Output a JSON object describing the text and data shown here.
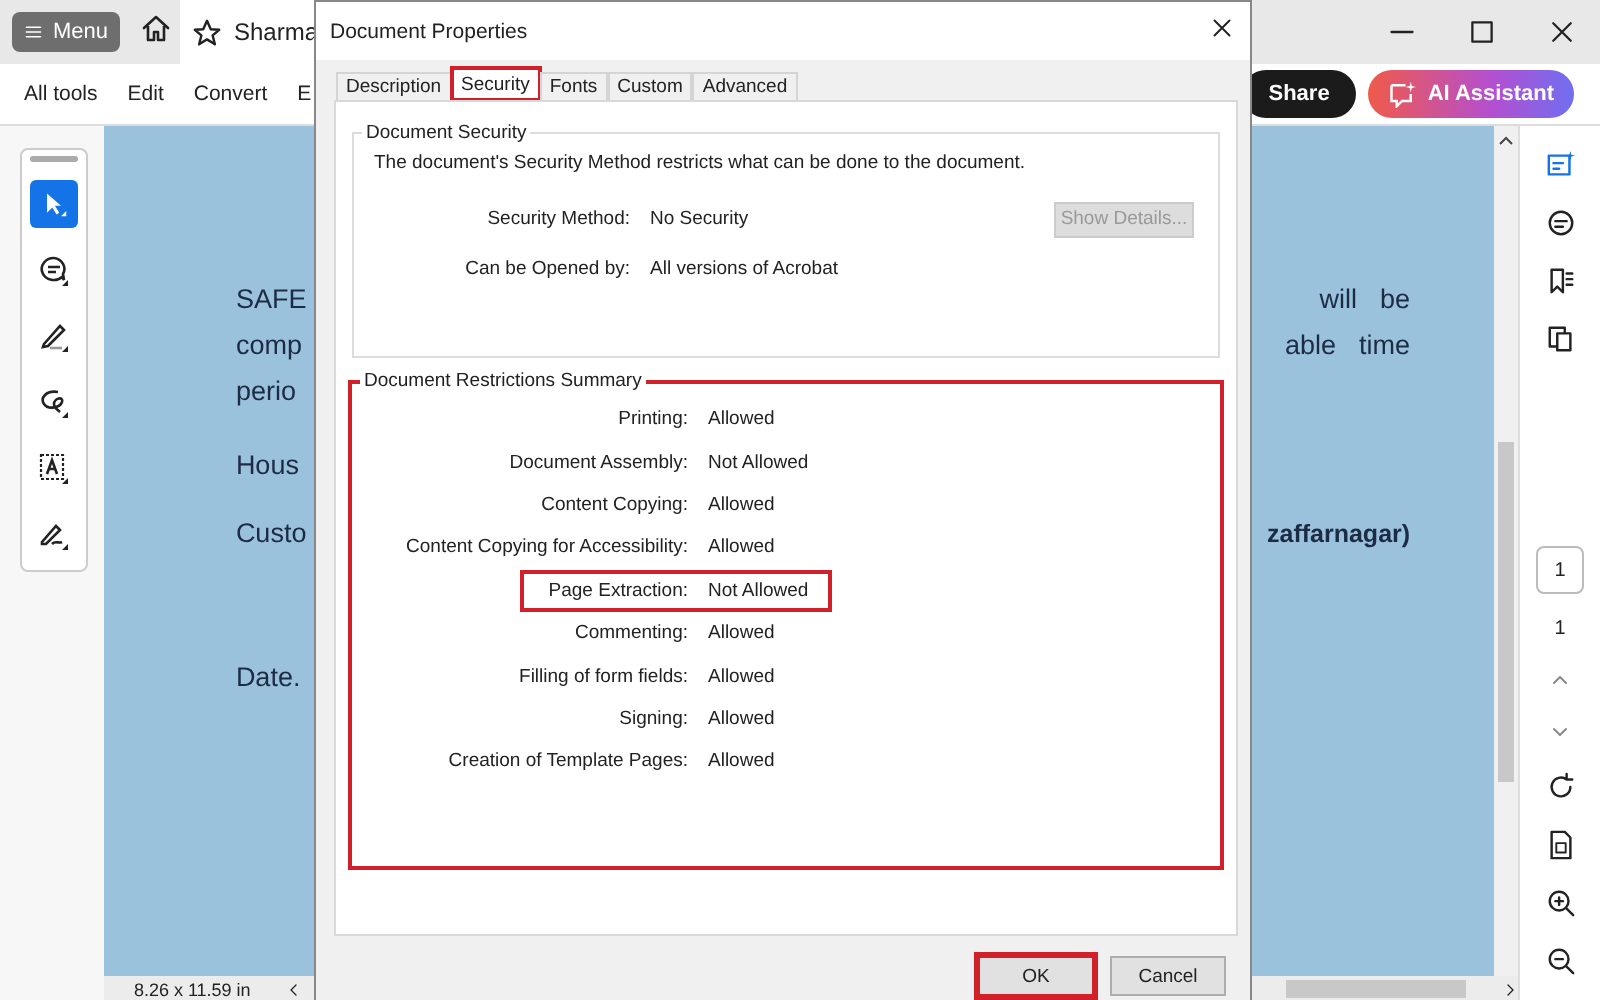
{
  "app": {
    "menu_button": "Menu",
    "tab_title": "Sharma",
    "toolbar": [
      "All tools",
      "Edit",
      "Convert",
      "E"
    ],
    "share": "Share",
    "ai_assistant": "AI Assistant"
  },
  "tools": [
    {
      "kind": "select",
      "selected": true
    },
    {
      "kind": "comment",
      "selected": false
    },
    {
      "kind": "draw",
      "selected": false
    },
    {
      "kind": "lasso",
      "selected": false
    },
    {
      "kind": "text",
      "selected": false
    },
    {
      "kind": "sign",
      "selected": false
    }
  ],
  "document": {
    "lines": [
      {
        "left": "SAFE",
        "right": "will  be",
        "bold": false
      },
      {
        "left": "comp",
        "right": "able  time",
        "bold": false
      },
      {
        "left": "perio"
      },
      {
        "left": "Hous"
      },
      {
        "left": "Custo",
        "right": "zaffarnagar)",
        "bold": true
      },
      {
        "left": "Date."
      }
    ]
  },
  "status_bar": "8.26 x 11.59 in",
  "page_nav": {
    "current": "1",
    "total": "1"
  },
  "dialog": {
    "title": "Document Properties",
    "tabs": [
      {
        "label": "Description",
        "selected": false,
        "highlighted": false
      },
      {
        "label": "Security",
        "selected": true,
        "highlighted": true
      },
      {
        "label": "Fonts",
        "selected": false,
        "highlighted": false
      },
      {
        "label": "Custom",
        "selected": false,
        "highlighted": false
      },
      {
        "label": "Advanced",
        "selected": false,
        "highlighted": false
      }
    ],
    "security": {
      "legend": "Document Security",
      "intro": "The document's Security Method restricts what can be done to the document.",
      "fields": [
        {
          "label": "Security Method:",
          "value": "No Security"
        },
        {
          "label": "Can be Opened by:",
          "value": "All versions of Acrobat"
        }
      ],
      "show_details": {
        "label": "Show Details...",
        "disabled": true
      }
    },
    "restrictions": {
      "legend": "Document Restrictions Summary",
      "highlighted": true,
      "rows": [
        {
          "label": "Printing:",
          "value": "Allowed",
          "highlighted": false
        },
        {
          "label": "Document Assembly:",
          "value": "Not Allowed",
          "highlighted": false
        },
        {
          "label": "Content Copying:",
          "value": "Allowed",
          "highlighted": false
        },
        {
          "label": "Content Copying for Accessibility:",
          "value": "Allowed",
          "highlighted": false
        },
        {
          "label": "Page Extraction:",
          "value": "Not Allowed",
          "highlighted": true
        },
        {
          "label": "Commenting:",
          "value": "Allowed",
          "highlighted": false
        },
        {
          "label": "Filling of form fields:",
          "value": "Allowed",
          "highlighted": false
        },
        {
          "label": "Signing:",
          "value": "Allowed",
          "highlighted": false
        },
        {
          "label": "Creation of Template Pages:",
          "value": "Allowed",
          "highlighted": false
        }
      ]
    },
    "buttons": [
      {
        "label": "OK",
        "highlighted": true
      },
      {
        "label": "Cancel",
        "highlighted": false
      }
    ]
  }
}
